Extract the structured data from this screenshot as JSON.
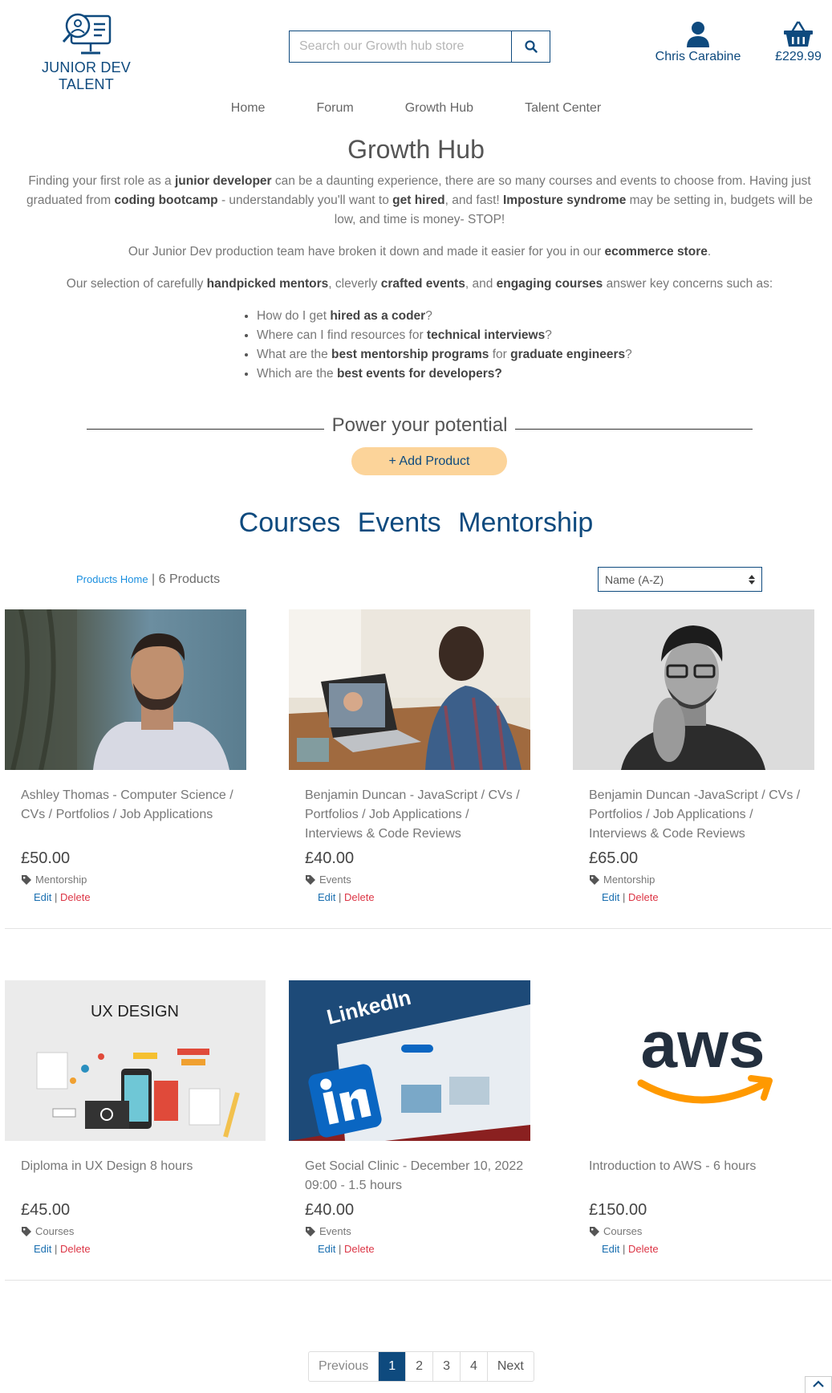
{
  "brand": {
    "name": "JUNIOR DEV TALENT"
  },
  "search": {
    "placeholder": "Search our Growth hub store"
  },
  "account": {
    "name": "Chris Carabine"
  },
  "cart": {
    "total": "£229.99"
  },
  "nav": [
    "Home",
    "Forum",
    "Growth Hub",
    "Talent Center"
  ],
  "page": {
    "title": "Growth Hub",
    "p1": [
      {
        "t": "Finding your first role as a "
      },
      {
        "b": "junior developer"
      },
      {
        "t": " can be a daunting experience, there are so many courses and events to choose from. Having just graduated from "
      },
      {
        "b": "coding bootcamp"
      },
      {
        "t": " - understandably you'll want to "
      },
      {
        "b": "get hired"
      },
      {
        "t": ", and fast! "
      },
      {
        "b": "Imposture syndrome"
      },
      {
        "t": " may be setting in, budgets will be low, and time is money- STOP!"
      }
    ],
    "p2": [
      {
        "t": "Our Junior Dev production team have broken it down and made it easier for you in our "
      },
      {
        "b": "ecommerce store"
      },
      {
        "t": "."
      }
    ],
    "p3": [
      {
        "t": "Our selection of carefully "
      },
      {
        "b": "handpicked mentors"
      },
      {
        "t": ", cleverly "
      },
      {
        "b": "crafted events"
      },
      {
        "t": ", and "
      },
      {
        "b": "engaging courses"
      },
      {
        "t": " answer key concerns such as:"
      }
    ],
    "concerns": [
      [
        {
          "t": "How do I get "
        },
        {
          "b": "hired as a coder"
        },
        {
          "t": "?"
        }
      ],
      [
        {
          "t": "Where can I find resources for "
        },
        {
          "b": "technical interviews"
        },
        {
          "t": "?"
        }
      ],
      [
        {
          "t": "What are the "
        },
        {
          "b": "best mentorship programs"
        },
        {
          "t": " for "
        },
        {
          "b": "graduate engineers"
        },
        {
          "t": "?"
        }
      ],
      [
        {
          "t": "Which are the "
        },
        {
          "b": "best events for developers?"
        }
      ]
    ],
    "potential": "Power your potential",
    "add_product": "+ Add Product",
    "categories": [
      "Courses",
      "Events",
      "Mentorship"
    ]
  },
  "listing": {
    "home_link": "Products Home",
    "separator": " | ",
    "count": "6 Products",
    "sort": "Name (A-Z)"
  },
  "actions": {
    "edit": "Edit",
    "sep": " | ",
    "delete": "Delete"
  },
  "products": [
    {
      "name": "Ashley Thomas - Computer Science / CVs / Portfolios / Job Applications",
      "price": "£50.00",
      "category": "Mentorship",
      "image": "portrait-photo"
    },
    {
      "name": "Benjamin Duncan - JavaScript / CVs / Portfolios / Job Applications / Interviews & Code Reviews",
      "price": "£40.00",
      "category": "Events",
      "image": "laptop-video-call-photo"
    },
    {
      "name": "Benjamin Duncan -JavaScript / CVs / Portfolios / Job Applications / Interviews & Code Reviews",
      "price": "£65.00",
      "category": "Mentorship",
      "image": "bw-portrait-photo"
    },
    {
      "name": "Diploma in UX Design 8 hours",
      "price": "£45.00",
      "category": "Courses",
      "image": "ux-design-illustration",
      "image_text": "UX DESIGN"
    },
    {
      "name": "Get Social Clinic - December 10, 2022 09:00 - 1.5 hours",
      "price": "£40.00",
      "category": "Events",
      "image": "linkedin-tablet-photo",
      "image_text": "LinkedIn"
    },
    {
      "name": "Introduction to AWS - 6 hours",
      "price": "£150.00",
      "category": "Courses",
      "image": "aws-logo",
      "image_text": "aws"
    }
  ],
  "pagination": {
    "prev": "Previous",
    "pages": [
      "1",
      "2",
      "3",
      "4"
    ],
    "next": "Next",
    "active": "1"
  },
  "colors": {
    "brand": "#0e4a7e",
    "accent": "#fcd49a",
    "delete": "#dc3545",
    "link": "#1a8fdf"
  }
}
